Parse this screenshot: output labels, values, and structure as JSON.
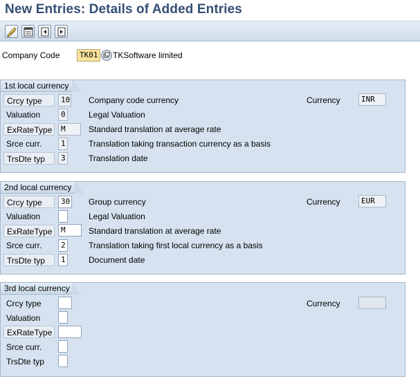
{
  "title": "New Entries: Details of Added Entries",
  "toolbar": {
    "icons": [
      "edit-pencil-icon",
      "display-change-icon",
      "previous-entry-icon",
      "next-entry-icon"
    ]
  },
  "company": {
    "label": "Company Code",
    "code": "TK01",
    "name": "TKSoftware limited"
  },
  "groups": [
    {
      "title": "1st local currency",
      "currency_label": "Currency",
      "currency_value": "INR",
      "rows": [
        {
          "label": "Crcy type",
          "value": "10",
          "desc": "Company code currency"
        },
        {
          "label": "Valuation",
          "value": "0",
          "desc": "Legal Valuation"
        },
        {
          "label": "ExRateType",
          "value": "M",
          "desc": "Standard translation at average rate"
        },
        {
          "label": "Srce curr.",
          "value": "1",
          "desc": "Translation taking transaction currency as a basis"
        },
        {
          "label": "TrsDte typ",
          "value": "3",
          "desc": "Translation date"
        }
      ]
    },
    {
      "title": "2nd local currency",
      "currency_label": "Currency",
      "currency_value": "EUR",
      "rows": [
        {
          "label": "Crcy type",
          "value": "30",
          "desc": "Group currency"
        },
        {
          "label": "Valuation",
          "value": "",
          "desc": "Legal Valuation"
        },
        {
          "label": "ExRateType",
          "value": "M",
          "desc": "Standard translation at average rate"
        },
        {
          "label": "Srce curr.",
          "value": "2",
          "desc": "Translation taking first local currency as a basis"
        },
        {
          "label": "TrsDte typ",
          "value": "1",
          "desc": "Document date"
        }
      ]
    },
    {
      "title": "3rd local currency",
      "currency_label": "Currency",
      "currency_value": "",
      "rows": [
        {
          "label": "Crcy type",
          "value": "",
          "desc": ""
        },
        {
          "label": "Valuation",
          "value": "",
          "desc": ""
        },
        {
          "label": "ExRateType",
          "value": "",
          "desc": ""
        },
        {
          "label": "Srce curr.",
          "value": "",
          "desc": ""
        },
        {
          "label": "TrsDte typ",
          "value": "",
          "desc": ""
        }
      ]
    }
  ]
}
